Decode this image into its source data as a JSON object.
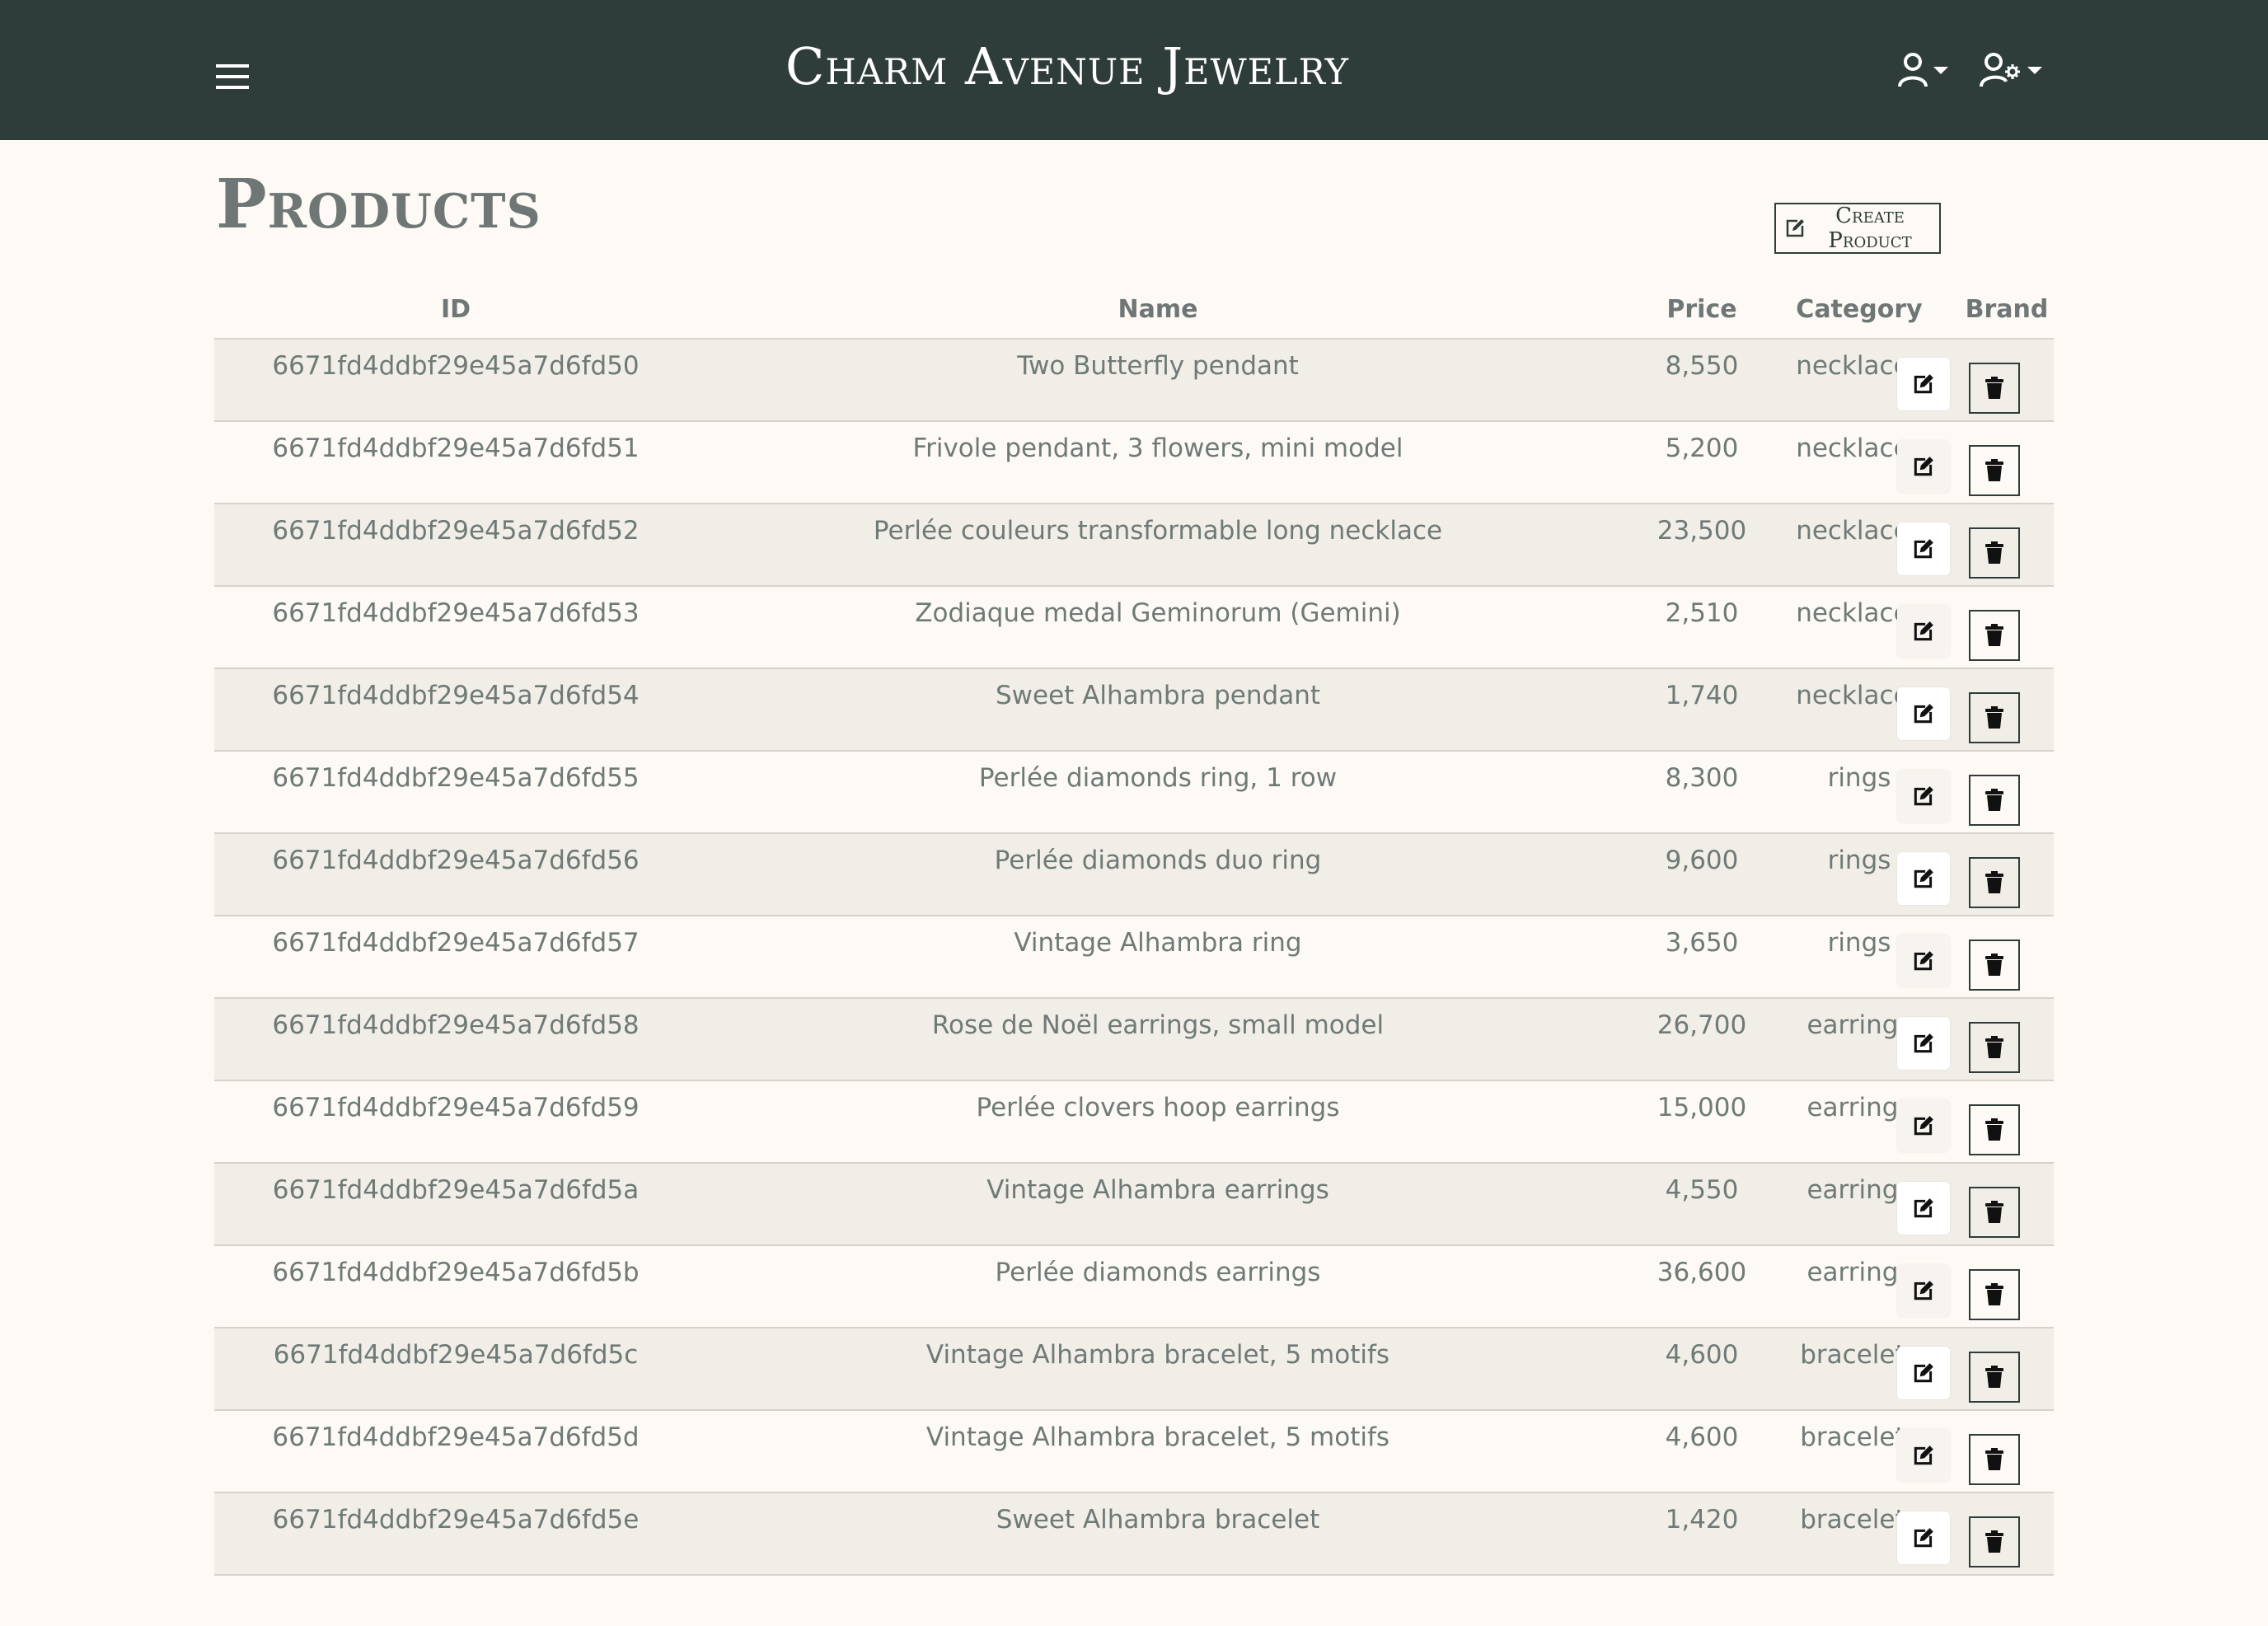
{
  "header": {
    "brand": "Charm Avenue Jewelry",
    "menu_icon": "hamburger-icon",
    "user_icon": "user-icon",
    "admin_icon": "user-gear-icon"
  },
  "page": {
    "title": "Products",
    "create_button_label": "Create Product",
    "create_icon": "edit-square-icon"
  },
  "table": {
    "columns": [
      "ID",
      "Name",
      "Price",
      "Category",
      "Brand"
    ],
    "actions": {
      "edit_icon": "edit-icon",
      "delete_icon": "trash-icon"
    },
    "rows": [
      {
        "id": "6671fd4ddbf29e45a7d6fd50",
        "name": "Two Butterfly pendant",
        "price": "8,550",
        "category": "necklaces",
        "brand": ""
      },
      {
        "id": "6671fd4ddbf29e45a7d6fd51",
        "name": "Frivole pendant, 3 flowers, mini model",
        "price": "5,200",
        "category": "necklaces",
        "brand": ""
      },
      {
        "id": "6671fd4ddbf29e45a7d6fd52",
        "name": "Perlée couleurs transformable long necklace",
        "price": "23,500",
        "category": "necklaces",
        "brand": ""
      },
      {
        "id": "6671fd4ddbf29e45a7d6fd53",
        "name": "Zodiaque medal Geminorum (Gemini)",
        "price": "2,510",
        "category": "necklaces",
        "brand": ""
      },
      {
        "id": "6671fd4ddbf29e45a7d6fd54",
        "name": "Sweet Alhambra pendant",
        "price": "1,740",
        "category": "necklaces",
        "brand": ""
      },
      {
        "id": "6671fd4ddbf29e45a7d6fd55",
        "name": "Perlée diamonds ring, 1 row",
        "price": "8,300",
        "category": "rings",
        "brand": ""
      },
      {
        "id": "6671fd4ddbf29e45a7d6fd56",
        "name": "Perlée diamonds duo ring",
        "price": "9,600",
        "category": "rings",
        "brand": ""
      },
      {
        "id": "6671fd4ddbf29e45a7d6fd57",
        "name": "Vintage Alhambra ring",
        "price": "3,650",
        "category": "rings",
        "brand": ""
      },
      {
        "id": "6671fd4ddbf29e45a7d6fd58",
        "name": "Rose de Noël earrings, small model",
        "price": "26,700",
        "category": "earrings",
        "brand": ""
      },
      {
        "id": "6671fd4ddbf29e45a7d6fd59",
        "name": "Perlée clovers hoop earrings",
        "price": "15,000",
        "category": "earrings",
        "brand": ""
      },
      {
        "id": "6671fd4ddbf29e45a7d6fd5a",
        "name": "Vintage Alhambra earrings",
        "price": "4,550",
        "category": "earrings",
        "brand": ""
      },
      {
        "id": "6671fd4ddbf29e45a7d6fd5b",
        "name": "Perlée diamonds earrings",
        "price": "36,600",
        "category": "earrings",
        "brand": ""
      },
      {
        "id": "6671fd4ddbf29e45a7d6fd5c",
        "name": "Vintage Alhambra bracelet, 5 motifs",
        "price": "4,600",
        "category": "bracelets",
        "brand": ""
      },
      {
        "id": "6671fd4ddbf29e45a7d6fd5d",
        "name": "Vintage Alhambra bracelet, 5 motifs",
        "price": "4,600",
        "category": "bracelets",
        "brand": ""
      },
      {
        "id": "6671fd4ddbf29e45a7d6fd5e",
        "name": "Sweet Alhambra bracelet",
        "price": "1,420",
        "category": "bracelets",
        "brand": ""
      }
    ]
  },
  "colors": {
    "navbar": "#2f3d3a",
    "background": "#fdf9f4",
    "stripe": "#f1ede7",
    "text": "#6f7a76"
  }
}
